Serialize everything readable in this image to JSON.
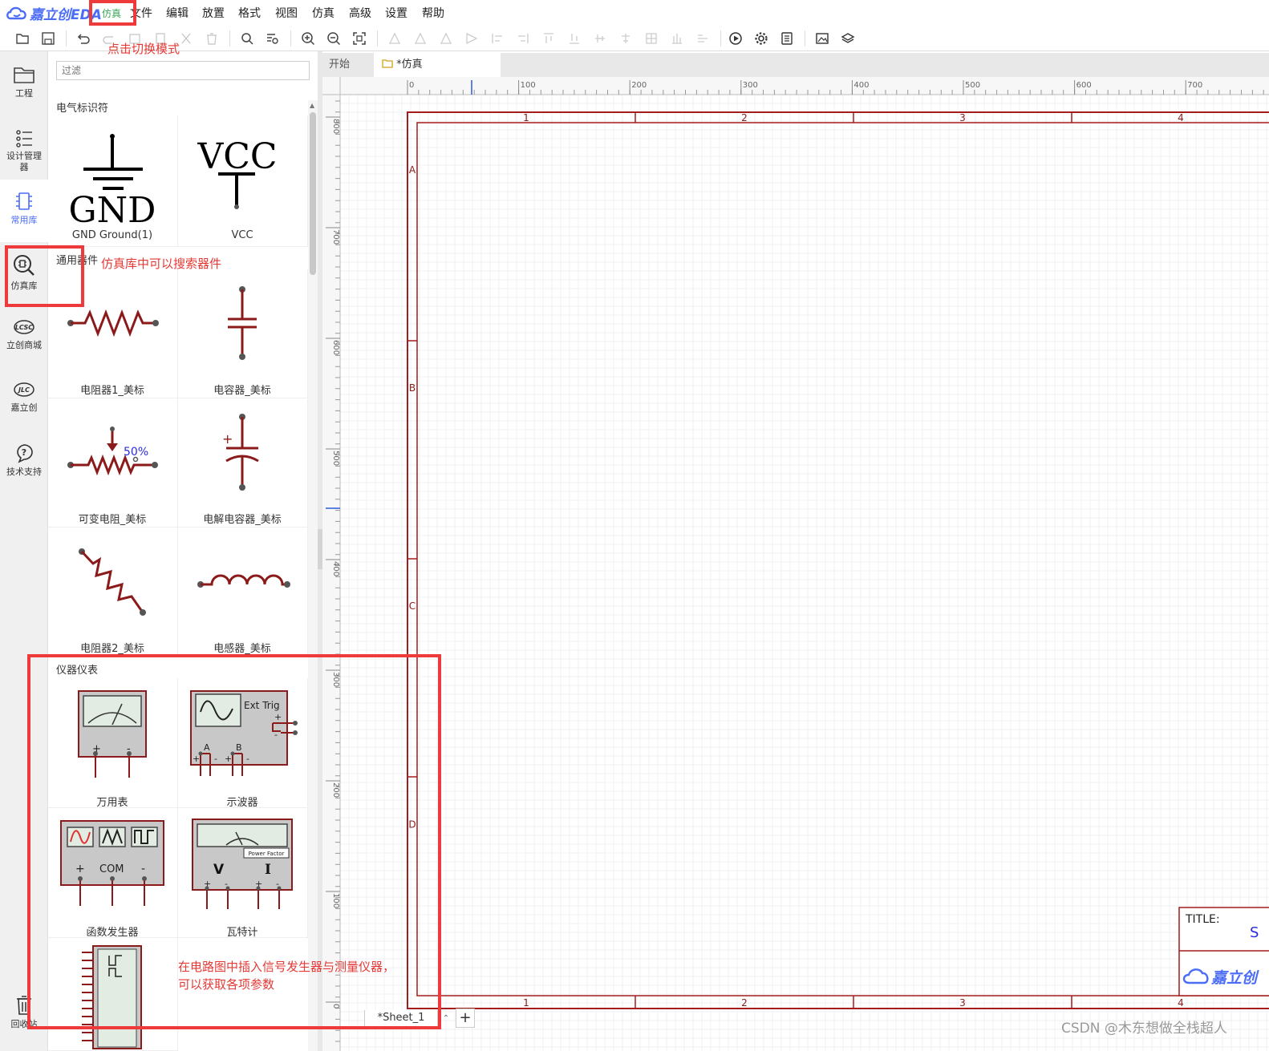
{
  "app": {
    "logo_text": "嘉立创EDA",
    "mode_label": "仿真"
  },
  "menu": [
    "文件",
    "编辑",
    "放置",
    "格式",
    "视图",
    "仿真",
    "高级",
    "设置",
    "帮助"
  ],
  "annotations": {
    "switch_mode": "点击切换模式",
    "search_hint": "仿真库中可以搜索器件",
    "instrument_hint_1": "在电路图中插入信号发生器与测量仪器，",
    "instrument_hint_2": "可以获取各项参数"
  },
  "leftnav": [
    {
      "icon": "folder-icon",
      "label": "工程"
    },
    {
      "icon": "design-manager-icon",
      "label": "设计管理器"
    },
    {
      "icon": "chip-icon",
      "label": "常用库"
    },
    {
      "icon": "search-chip-icon",
      "label": "仿真库"
    },
    {
      "icon": "lcsc-icon",
      "label": "立创商城"
    },
    {
      "icon": "jlc-icon",
      "label": "嘉立创"
    },
    {
      "icon": "help-icon",
      "label": "技术支持"
    },
    {
      "icon": "trash-icon",
      "label": "回收站"
    }
  ],
  "library": {
    "filter_placeholder": "过滤",
    "sections": {
      "electrical": "电气标识符",
      "general": "通用器件",
      "instruments": "仪器仪表"
    },
    "items": {
      "gnd": "GND Ground(1)",
      "vcc": "VCC",
      "resistor1": "电阻器1_美标",
      "capacitor": "电容器_美标",
      "varres": "可变电阻_美标",
      "electrolytic": "电解电容器_美标",
      "resistor2": "电阻器2_美标",
      "inductor": "电感器_美标",
      "multimeter": "万用表",
      "oscilloscope": "示波器",
      "funcgen": "函数发生器",
      "wattmeter": "瓦特计"
    },
    "symbols": {
      "gnd_text": "GND",
      "vcc_text": "VCC",
      "varres_pct": "50%",
      "osc_trig": "Ext Trig",
      "osc_a": "A",
      "osc_b": "B",
      "fg_com": "COM",
      "wm_v": "V",
      "wm_i": "I",
      "wm_pf": "Power Factor",
      "plus": "+",
      "minus": "-"
    }
  },
  "tabs": {
    "start": "开始",
    "sim": "*仿真"
  },
  "sheet": {
    "tab": "*Sheet_1",
    "add": "+",
    "title_label": "TITLE:",
    "title_value": "S",
    "brand": "嘉立创"
  },
  "ruler": {
    "top": [
      "0",
      "100",
      "200",
      "300",
      "400",
      "500",
      "600",
      "700"
    ],
    "left": [
      "800",
      "700",
      "600",
      "500",
      "400",
      "300",
      "200",
      "100",
      "0"
    ]
  },
  "frame": {
    "cols": [
      "1",
      "2",
      "3",
      "4"
    ],
    "rows": [
      "A",
      "B",
      "C",
      "D"
    ]
  },
  "watermark": "CSDN @木东想做全栈超人",
  "colors": {
    "frame": "#a51c1c",
    "symbol": "#8b1a1a",
    "accent": "#4a6cf7",
    "annotation": "#ee3a3a"
  }
}
